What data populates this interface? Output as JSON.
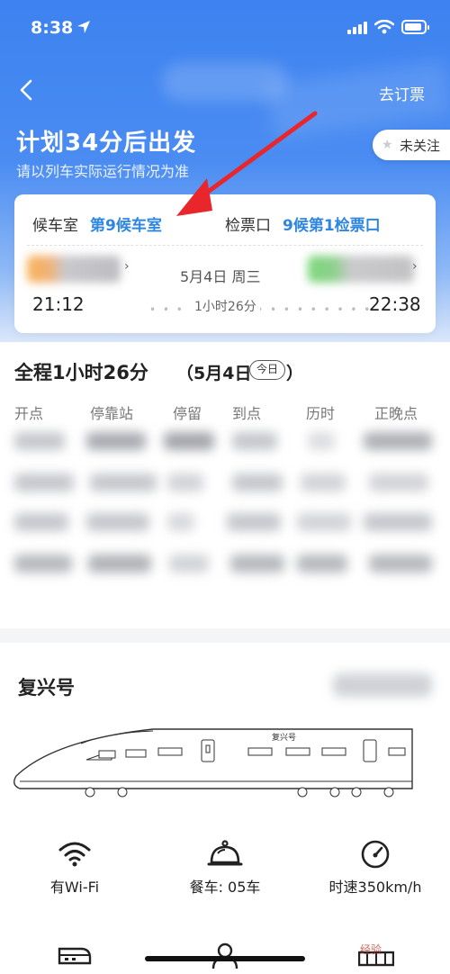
{
  "status_bar": {
    "time": "8:38"
  },
  "header": {
    "go_order": "去订票",
    "title": "计划34分后出发",
    "subtitle": "请以列车实际运行情况为准",
    "follow_label": "未关注"
  },
  "trip_card": {
    "waiting_room_label": "候车室",
    "waiting_room_value": "第9候车室",
    "gate_label": "检票口",
    "gate_value": "9候第1检票口",
    "date": "5月4日 周三",
    "depart_time": "21:12",
    "arrive_time": "22:38",
    "duration": "1小时26分"
  },
  "schedule": {
    "title": "全程1小时26分",
    "date_prefix": "（5月4日",
    "today_badge": "今日",
    "date_suffix": "）",
    "columns": [
      "开点",
      "停靠站",
      "停留",
      "到点",
      "历时",
      "正晚点"
    ]
  },
  "train": {
    "name": "复兴号",
    "train_text": "复兴号"
  },
  "features": [
    {
      "icon": "wifi-icon",
      "label": "有Wi-Fi"
    },
    {
      "icon": "dining-bell-icon",
      "label": "餐车: 05车"
    },
    {
      "icon": "speedometer-icon",
      "label": "时速350km/h"
    }
  ],
  "watermark": "经验",
  "colors": {
    "accent": "#2f86e0",
    "hero": "#3d82f0",
    "annotation_arrow": "#e8262c"
  }
}
